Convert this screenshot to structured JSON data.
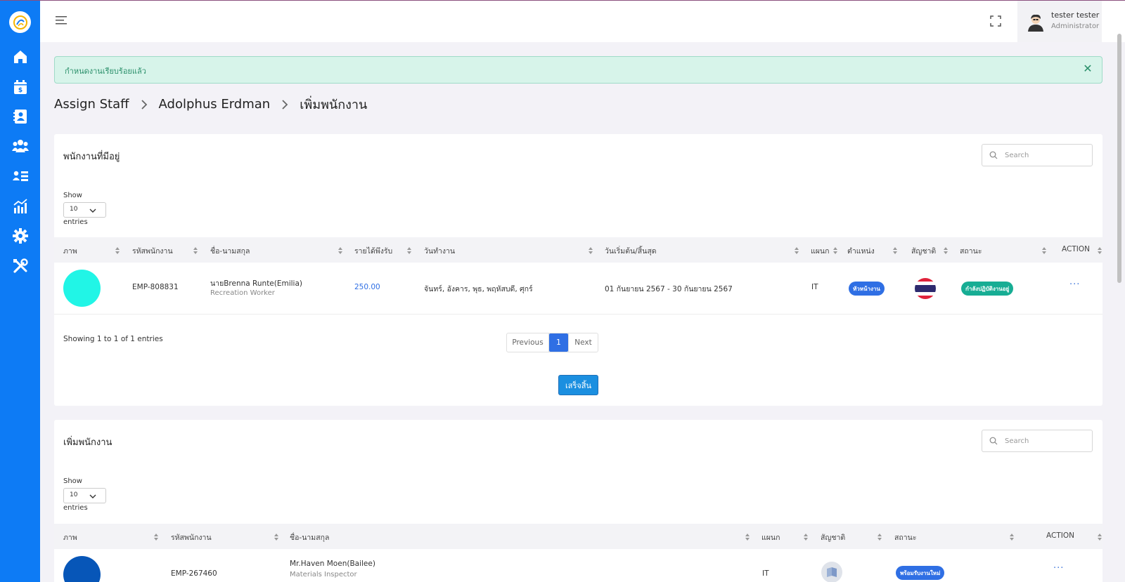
{
  "app": {
    "logo_icon": "app-logo-icon"
  },
  "sidebar": {
    "items": [
      {
        "icon": "home-icon"
      },
      {
        "icon": "calendar-dollar-icon"
      },
      {
        "icon": "contacts-icon"
      },
      {
        "icon": "team-icon"
      },
      {
        "icon": "staff-list-icon"
      },
      {
        "icon": "analytics-icon"
      },
      {
        "icon": "settings-icon"
      },
      {
        "icon": "tools-icon"
      }
    ]
  },
  "user": {
    "name": "tester tester",
    "role": "Administrator"
  },
  "alert": {
    "message": "กำหนดงานเรียบร้อยแล้ว",
    "close_icon": "close-icon"
  },
  "breadcrumb": {
    "items": [
      "Assign Staff",
      "Adolphus Erdman",
      "เพิ่มพนักงาน"
    ]
  },
  "existing": {
    "title": "พนักงานที่มีอยู่",
    "search_placeholder": "Search",
    "show_label": "Show",
    "page_size": "10",
    "entries_label": "entries",
    "columns": [
      "ภาพ",
      "รหัสพนักงาน",
      "ชื่อ-นามสกุล",
      "รายได้พึงรับ",
      "วันทำงาน",
      "วันเริ่มต้น/สิ้นสุด",
      "แผนก",
      "ตำแหน่ง",
      "สัญชาติ",
      "สถานะ",
      "ACTION"
    ],
    "rows": [
      {
        "photo_color": "#21f5e6",
        "emp_id": "EMP-808831",
        "name": "นายBrenna Runte(Emilia)",
        "job": "Recreation Worker",
        "income": "250.00",
        "workdays": "จันทร์, อังคาร, พุธ, พฤหัสบดี, ศุกร์",
        "period": "01 กันยายน 2567 - 30 กันยายน 2567",
        "department": "IT",
        "position": "หัวหน้างาน",
        "nationality": "thailand-flag-icon",
        "status": "กำลังปฏิบัติงานอยู่",
        "action": "···"
      }
    ],
    "showing_text": "Showing 1 to 1 of 1 entries",
    "pager": {
      "prev": "Previous",
      "current": "1",
      "next": "Next"
    },
    "finish_label": "เสร็จสิ้น"
  },
  "add": {
    "title": "เพิ่มพนักงาน",
    "search_placeholder": "Search",
    "show_label": "Show",
    "page_size": "10",
    "entries_label": "entries",
    "columns": [
      "ภาพ",
      "รหัสพนักงาน",
      "ชื่อ-นามสกุล",
      "แผนก",
      "สัญชาติ",
      "สถานะ",
      "ACTION"
    ],
    "rows": [
      {
        "photo_color": "#0756b8",
        "emp_id": "EMP-267460",
        "name": "Mr.Haven Moen(Bailee)",
        "job": "Materials Inspector",
        "department": "IT",
        "nationality": "flag-placeholder-icon",
        "status": "พร้อมรับงานใหม่",
        "action": "···"
      }
    ]
  },
  "colors": {
    "sidebar": "#0d7bf5",
    "primary": "#2f6fe4",
    "teal_badge": "#17ad94",
    "alert_bg": "#d7f4ea"
  }
}
